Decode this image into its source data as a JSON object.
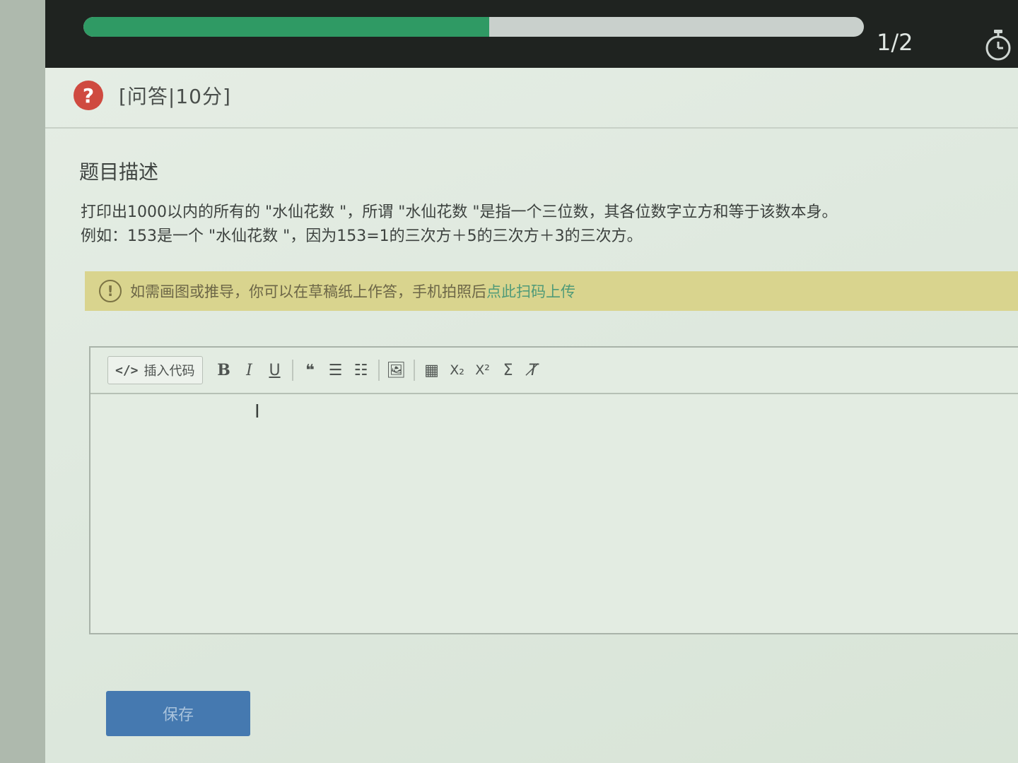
{
  "progress": {
    "fraction": 0.52,
    "text": "1/2"
  },
  "question": {
    "type_label": "[问答|10分]",
    "section_title": "题目描述",
    "description_line1": "打印出1000以内的所有的 \"水仙花数 \"，所谓 \"水仙花数 \"是指一个三位数，其各位数字立方和等于该数本身。",
    "description_line2": "例如：153是一个 \"水仙花数 \"，因为153=1的三次方＋5的三次方＋3的三次方。"
  },
  "notice": {
    "text": "如需画图或推导，你可以在草稿纸上作答，手机拍照后",
    "link_text": "点此扫码上传"
  },
  "toolbar": {
    "insert_code_label": "插入代码",
    "bold": "B",
    "italic": "I",
    "underline": "U",
    "quote": "❝",
    "ordered_list": "☰",
    "unordered_list": "☷",
    "image": "🖼",
    "table": "▦",
    "subscript": "X₂",
    "superscript": "X²",
    "formula": "Σ",
    "clear_format": "T̸"
  },
  "editor": {
    "content": ""
  },
  "save_label": "保存",
  "colors": {
    "progress_fill": "#2f9a64",
    "notice_bg": "#d9d48e",
    "link": "#4f9a78",
    "save_button": "#4579b0",
    "question_icon": "#cf4a40"
  }
}
